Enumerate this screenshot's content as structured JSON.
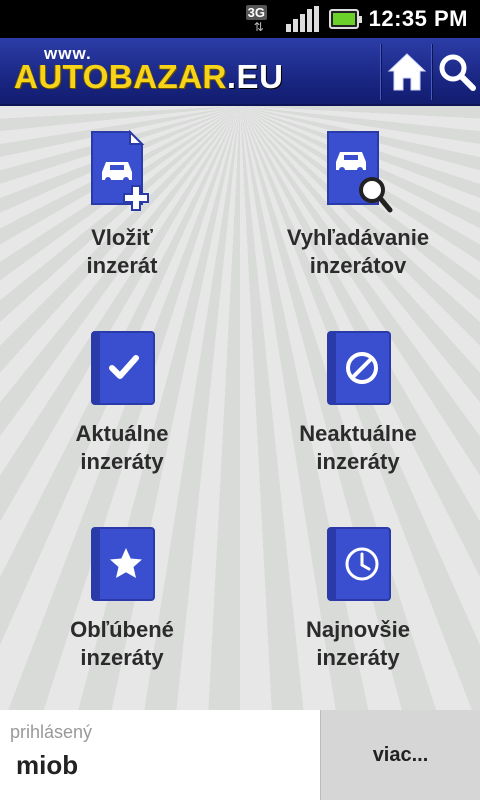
{
  "status_bar": {
    "network": "3G",
    "time": "12:35 PM"
  },
  "header": {
    "logo_www": "www.",
    "logo_main": "AUTOBAZAR",
    "logo_suffix": ".EU",
    "home_icon": "home-icon",
    "search_icon": "search-icon"
  },
  "menu": [
    {
      "line1": "Vložiť",
      "line2": "inzerát",
      "icon": "add-ad-icon"
    },
    {
      "line1": "Vyhľadávanie",
      "line2": "inzerátov",
      "icon": "search-ads-icon"
    },
    {
      "line1": "Aktuálne",
      "line2": "inzeráty",
      "icon": "check-book-icon"
    },
    {
      "line1": "Neaktuálne",
      "line2": "inzeráty",
      "icon": "blocked-book-icon"
    },
    {
      "line1": "Obľúbené",
      "line2": "inzeráty",
      "icon": "star-book-icon"
    },
    {
      "line1": "Najnovšie",
      "line2": "inzeráty",
      "icon": "clock-book-icon"
    }
  ],
  "footer": {
    "user_caption": "prihlásený",
    "username": "miob",
    "more_label": "viac..."
  },
  "colors": {
    "header_blue": "#1a2784",
    "logo_yellow": "#f7d41a",
    "icon_blue": "#3a4fcf"
  }
}
